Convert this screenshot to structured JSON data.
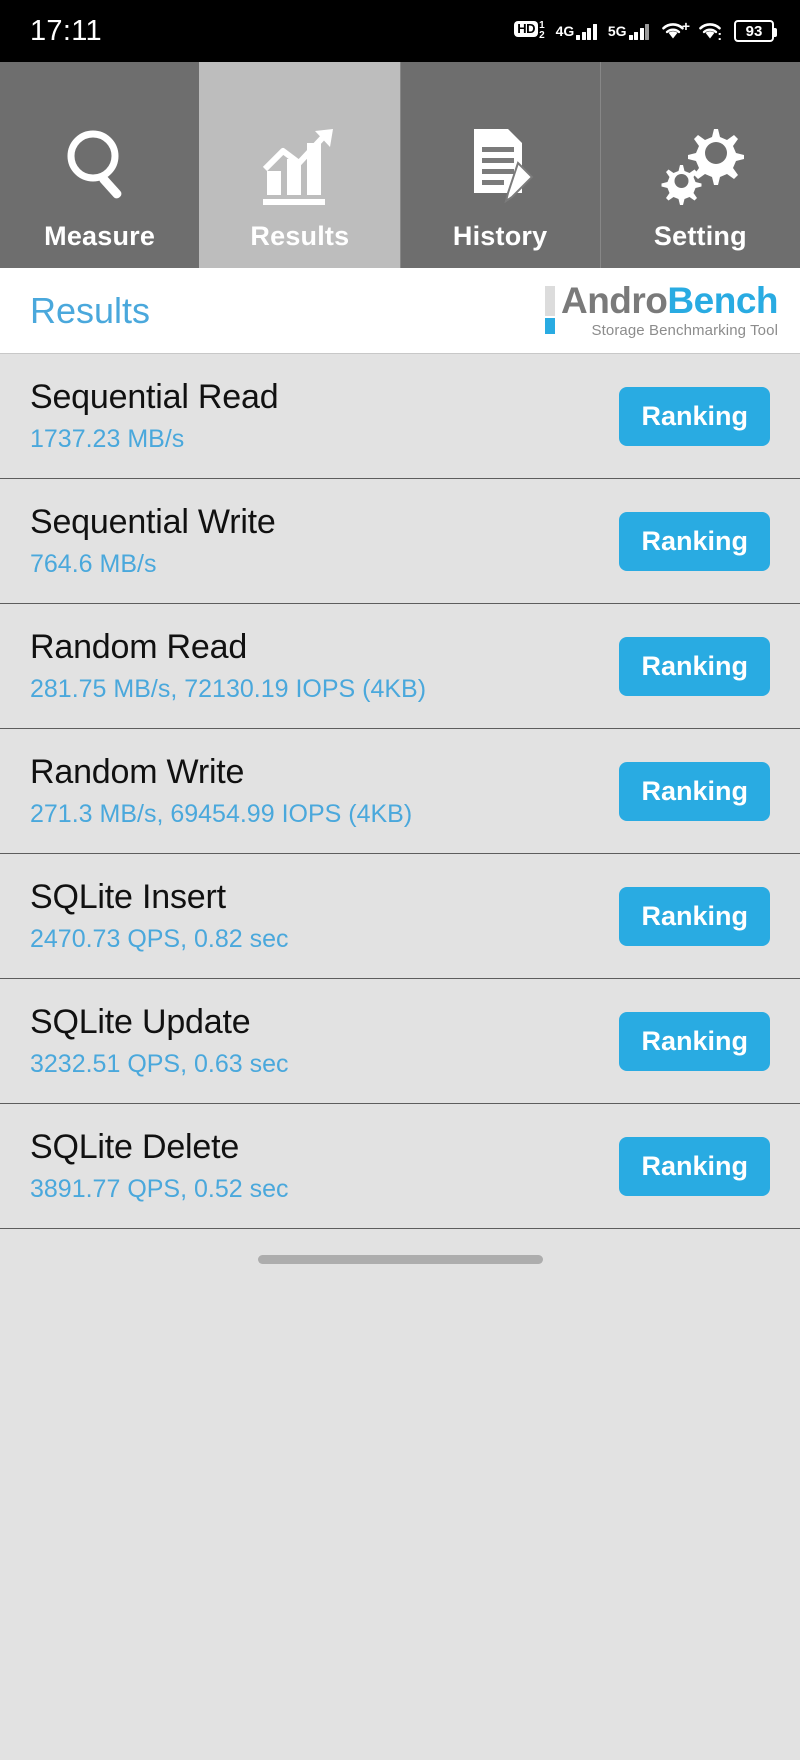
{
  "status_bar": {
    "time": "17:11",
    "hd_label": "HD",
    "hd_sup": "1",
    "hd_sub": "2",
    "net1": "4G",
    "net2": "5G",
    "wifi_plus": "+",
    "wifi_dot": ":",
    "battery": "93",
    "icons": [
      "hd-voice-icon",
      "4g-signal-icon",
      "5g-signal-icon",
      "wifi-plus-icon",
      "wifi-icon",
      "battery-icon"
    ]
  },
  "tabs": [
    {
      "label": "Measure",
      "icon": "magnifier-icon",
      "active": false
    },
    {
      "label": "Results",
      "icon": "bar-chart-icon",
      "active": true
    },
    {
      "label": "History",
      "icon": "document-pencil-icon",
      "active": false
    },
    {
      "label": "Setting",
      "icon": "gears-icon",
      "active": false
    }
  ],
  "header": {
    "title": "Results",
    "logo_andro": "Andro",
    "logo_bench": "Bench",
    "logo_subtitle": "Storage Benchmarking Tool"
  },
  "results": [
    {
      "name": "Sequential Read",
      "value": "1737.23 MB/s",
      "button": "Ranking"
    },
    {
      "name": "Sequential Write",
      "value": "764.6 MB/s",
      "button": "Ranking"
    },
    {
      "name": "Random Read",
      "value": "281.75 MB/s, 72130.19 IOPS (4KB)",
      "button": "Ranking"
    },
    {
      "name": "Random Write",
      "value": "271.3 MB/s, 69454.99 IOPS (4KB)",
      "button": "Ranking"
    },
    {
      "name": "SQLite Insert",
      "value": "2470.73 QPS, 0.82 sec",
      "button": "Ranking"
    },
    {
      "name": "SQLite Update",
      "value": "3232.51 QPS, 0.63 sec",
      "button": "Ranking"
    },
    {
      "name": "SQLite Delete",
      "value": "3891.77 QPS, 0.52 sec",
      "button": "Ranking"
    }
  ],
  "colors": {
    "accent_blue": "#29abe2",
    "value_blue": "#4aa8dc",
    "tab_inactive": "#6e6e6e",
    "tab_active": "#bdbdbd",
    "list_bg": "#e2e2e2"
  }
}
